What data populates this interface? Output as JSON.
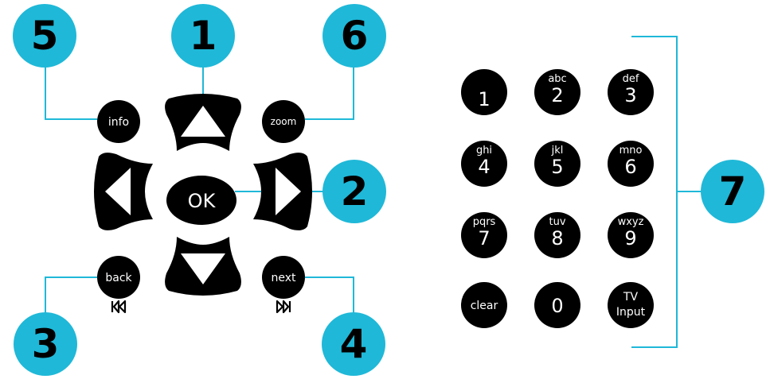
{
  "accent_color": "#1fb8d8",
  "button_color": "#000000",
  "callouts": {
    "c1": "1",
    "c2": "2",
    "c3": "3",
    "c4": "4",
    "c5": "5",
    "c6": "6",
    "c7": "7"
  },
  "dpad": {
    "ok_label": "OK",
    "info_label": "info",
    "zoom_label": "zoom",
    "back_label": "back",
    "next_label": "next",
    "icons": [
      "up-arrow-icon",
      "down-arrow-icon",
      "left-arrow-icon",
      "right-arrow-icon",
      "skip-back-icon",
      "skip-forward-icon"
    ]
  },
  "keypad": [
    {
      "digit": "1",
      "letters": ""
    },
    {
      "digit": "2",
      "letters": "abc"
    },
    {
      "digit": "3",
      "letters": "def"
    },
    {
      "digit": "4",
      "letters": "ghi"
    },
    {
      "digit": "5",
      "letters": "jkl"
    },
    {
      "digit": "6",
      "letters": "mno"
    },
    {
      "digit": "7",
      "letters": "pqrs"
    },
    {
      "digit": "8",
      "letters": "tuv"
    },
    {
      "digit": "9",
      "letters": "wxyz"
    },
    {
      "digit": "clear",
      "letters": ""
    },
    {
      "digit": "0",
      "letters": ""
    },
    {
      "digit": "TV",
      "letters": "Input"
    }
  ]
}
